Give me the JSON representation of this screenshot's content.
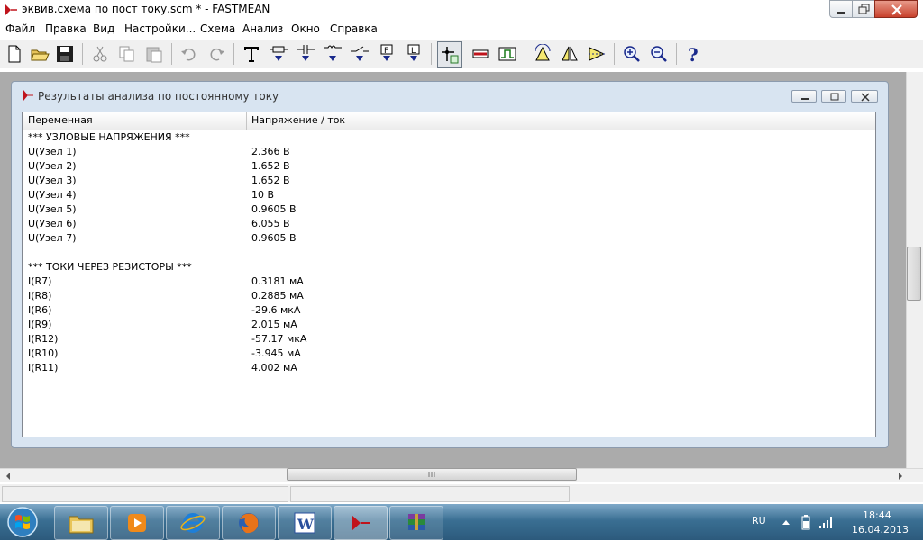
{
  "window": {
    "title": "эквив.схема по пост току.scm * - FASTMEAN"
  },
  "menu": [
    "Файл",
    "Правка",
    "Вид",
    "Настройки...",
    "Схема",
    "Анализ",
    "Окно",
    "Справка"
  ],
  "toolbar_icons": [
    "new-file-icon",
    "open-folder-icon",
    "save-icon",
    "cut-icon",
    "copy-icon",
    "paste-icon",
    "undo-icon",
    "redo-icon",
    "text-tool-icon",
    "resistor-icon",
    "capacitor-icon",
    "inductor-icon",
    "switch-icon",
    "filter-icon",
    "logic-block-icon",
    "node-marker-icon",
    "probe-icon",
    "pulse-icon",
    "rotate-icon",
    "mirror-icon",
    "flip-icon",
    "zoom-in-icon",
    "zoom-out-icon",
    "help-icon"
  ],
  "child_window": {
    "title": "Результаты анализа по постоянному току"
  },
  "list": {
    "columns": [
      "Переменная",
      "Напряжение / ток"
    ],
    "rows": [
      [
        "*** УЗЛОВЫЕ НАПРЯЖЕНИЯ ***",
        ""
      ],
      [
        "U(Узел 1)",
        "2.366 В"
      ],
      [
        "U(Узел 2)",
        "1.652 В"
      ],
      [
        "U(Узел 3)",
        "1.652 В"
      ],
      [
        "U(Узел 4)",
        "10 В"
      ],
      [
        "U(Узел 5)",
        "0.9605 В"
      ],
      [
        "U(Узел 6)",
        "6.055 В"
      ],
      [
        "U(Узел 7)",
        "0.9605 В"
      ],
      [
        "",
        ""
      ],
      [
        "*** ТОКИ ЧЕРЕЗ РЕЗИСТОРЫ ***",
        ""
      ],
      [
        "I(R7)",
        "0.3181 мА"
      ],
      [
        "I(R8)",
        "0.2885 мА"
      ],
      [
        "I(R6)",
        "-29.6 мкА"
      ],
      [
        "I(R9)",
        "2.015 мА"
      ],
      [
        "I(R12)",
        "-57.17 мкА"
      ],
      [
        "I(R10)",
        "-3.945 мА"
      ],
      [
        "I(R11)",
        "4.002 мА"
      ]
    ]
  },
  "taskbar": {
    "language": "RU",
    "time": "18:44",
    "date": "16.04.2013"
  },
  "colors": {
    "mdi_background": "#ababab",
    "child_frame": "#d8e4f1",
    "taskbar": "#3a6f93"
  }
}
